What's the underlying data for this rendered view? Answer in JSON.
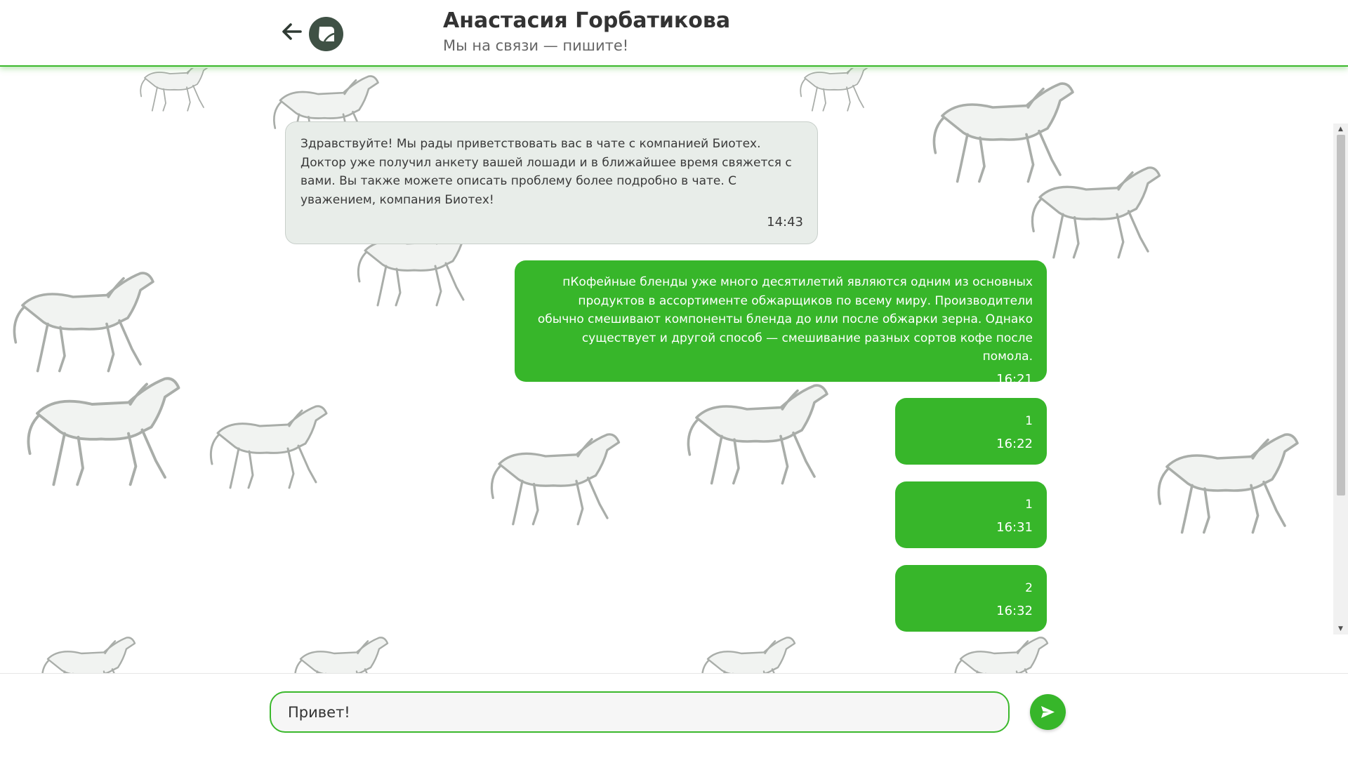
{
  "header": {
    "title": "Анастасия Горбатикова",
    "subtitle": "Мы на связи — пишите!"
  },
  "colors": {
    "accent": "#37b62a",
    "incoming_bubble": "#e8ede9",
    "logo": "#3f5145"
  },
  "icons": {
    "back": "arrow-left-icon",
    "logo": "leaf-logo-icon",
    "send": "send-icon"
  },
  "messages": [
    {
      "direction": "incoming",
      "text": "Здравствуйте! Мы рады приветствовать вас в чате с компанией Биотех. Доктор уже получил анкету вашей лошади и в ближайшее время свяжется с вами. Вы также можете описать проблему более подробно в чате. С уважением, компания Биотех!",
      "time": "14:43"
    },
    {
      "direction": "outgoing",
      "text": "пКофейные бленды уже много десятилетий являются одним из основных продуктов в ассортименте обжарщиков по всему миру. Производители обычно смешивают компоненты бленда до или после обжарки зерна. Однако существует и другой способ — смешивание разных сортов кофе после помола.",
      "time": "16:21"
    },
    {
      "direction": "outgoing",
      "text": "1",
      "time": "16:22"
    },
    {
      "direction": "outgoing",
      "text": "1",
      "time": "16:31"
    },
    {
      "direction": "outgoing",
      "text": "2",
      "time": "16:32"
    }
  ],
  "composer": {
    "value": "Привет!"
  }
}
